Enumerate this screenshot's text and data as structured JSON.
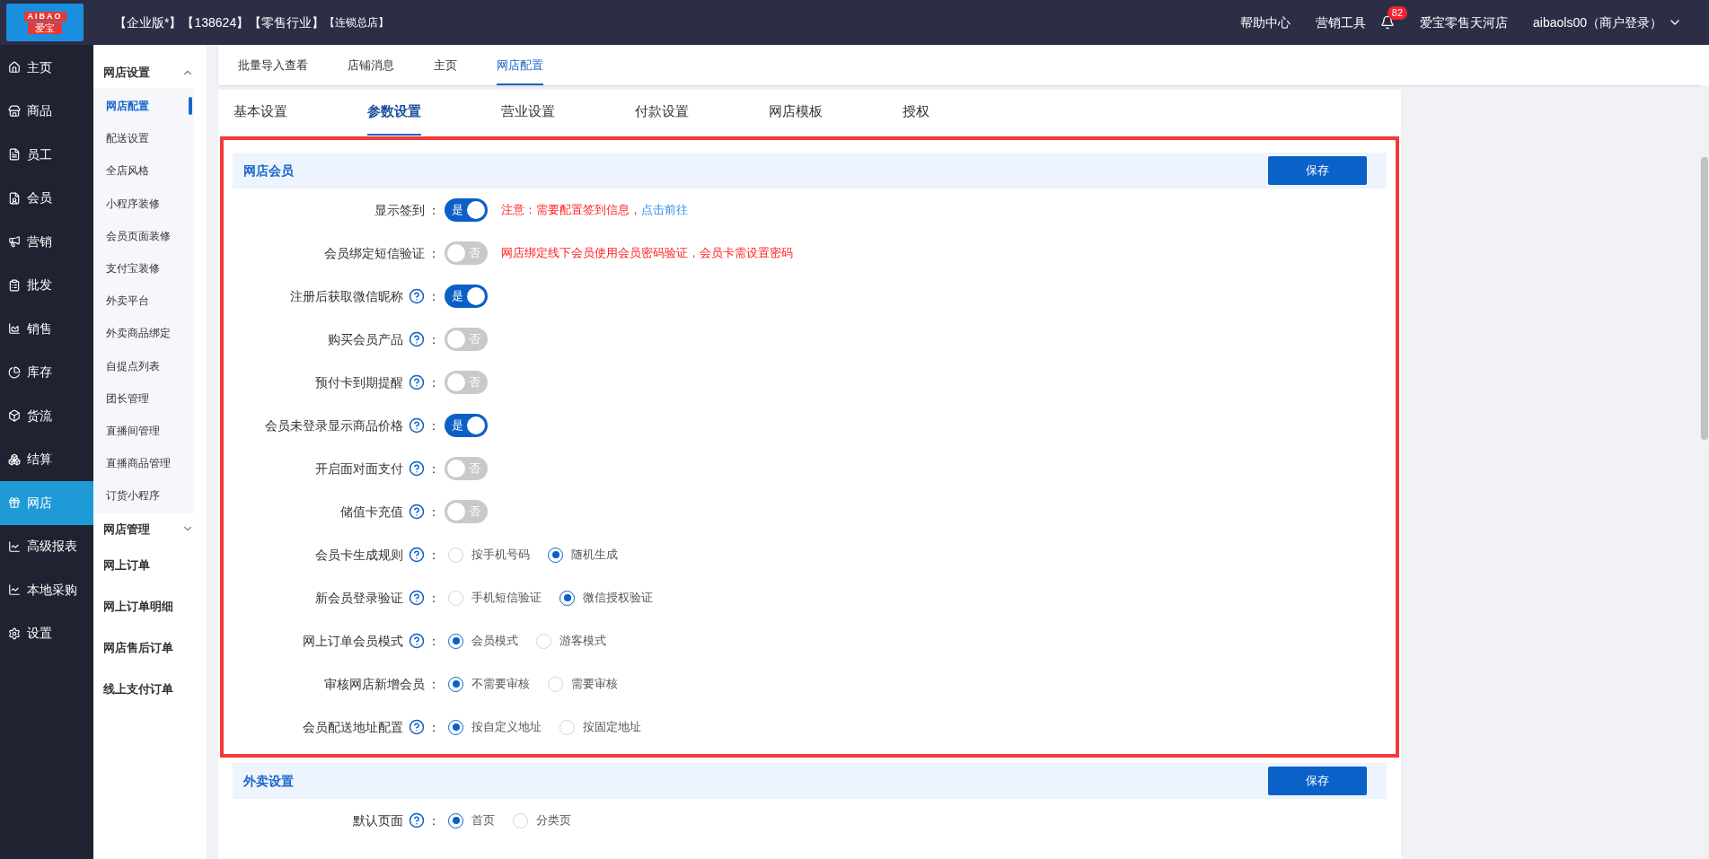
{
  "logo": {
    "text": "AIBAO",
    "subtext": "爱宝"
  },
  "header": {
    "tags": [
      {
        "text": "【企业版*】",
        "small": false
      },
      {
        "text": "【138624】",
        "small": false
      },
      {
        "text": "【零售行业】",
        "small": false
      },
      {
        "text": "【连锁总店】",
        "small": true
      }
    ],
    "links": [
      "帮助中心",
      "营销工具"
    ],
    "notification_count": "82",
    "store": "爱宝零售天河店",
    "user": "aibaols00（商户登录）"
  },
  "nav": [
    {
      "label": "主页",
      "selected": false
    },
    {
      "label": "商品",
      "selected": false
    },
    {
      "label": "员工",
      "selected": false
    },
    {
      "label": "会员",
      "selected": false
    },
    {
      "label": "营销",
      "selected": false
    },
    {
      "label": "批发",
      "selected": false
    },
    {
      "label": "销售",
      "selected": false
    },
    {
      "label": "库存",
      "selected": false
    },
    {
      "label": "货流",
      "selected": false
    },
    {
      "label": "结算",
      "selected": false
    },
    {
      "label": "网店",
      "selected": true
    },
    {
      "label": "高级报表",
      "selected": false
    },
    {
      "label": "本地采购",
      "selected": false
    },
    {
      "label": "设置",
      "selected": false
    }
  ],
  "submenu": [
    {
      "kind": "group",
      "label": "网店设置",
      "expanded": true,
      "children": [
        {
          "label": "网店配置",
          "selected": true
        },
        {
          "label": "配送设置",
          "selected": false
        },
        {
          "label": "全店风格",
          "selected": false
        },
        {
          "label": "小程序装修",
          "selected": false
        },
        {
          "label": "会员页面装修",
          "selected": false
        },
        {
          "label": "支付宝装修",
          "selected": false
        },
        {
          "label": "外卖平台",
          "selected": false
        },
        {
          "label": "外卖商品绑定",
          "selected": false
        },
        {
          "label": "自提点列表",
          "selected": false
        },
        {
          "label": "团长管理",
          "selected": false
        },
        {
          "label": "直播间管理",
          "selected": false
        },
        {
          "label": "直播商品管理",
          "selected": false
        },
        {
          "label": "订货小程序",
          "selected": false
        }
      ]
    },
    {
      "kind": "group",
      "label": "网店管理",
      "expanded": false
    },
    {
      "kind": "link",
      "label": "网上订单"
    },
    {
      "kind": "link",
      "label": "网上订单明细"
    },
    {
      "kind": "link",
      "label": "网店售后订单"
    },
    {
      "kind": "link",
      "label": "线上支付订单"
    }
  ],
  "page_tabs": [
    {
      "label": "批量导入查看",
      "selected": false
    },
    {
      "label": "店铺消息",
      "selected": false
    },
    {
      "label": "主页",
      "selected": false
    },
    {
      "label": "网店配置",
      "selected": true
    }
  ],
  "settings_tabs": [
    {
      "label": "基本设置",
      "selected": false
    },
    {
      "label": "参数设置",
      "selected": true
    },
    {
      "label": "营业设置",
      "selected": false
    },
    {
      "label": "付款设置",
      "selected": false
    },
    {
      "label": "网店模板",
      "selected": false
    },
    {
      "label": "授权",
      "selected": false
    }
  ],
  "sections": [
    {
      "title": "网店会员",
      "highlighted": true,
      "save": "保存",
      "rows": [
        {
          "kind": "toggle",
          "label": "显示签到",
          "help": false,
          "suffix": "：",
          "on": true,
          "switch_text": "是",
          "note": {
            "text": "注意：需要配置签到信息，",
            "link": "点击前往"
          }
        },
        {
          "kind": "toggle",
          "label": "会员绑定短信验证",
          "help": false,
          "suffix": "：",
          "on": false,
          "switch_text": "否",
          "note": {
            "text": "网店绑定线下会员使用会员密码验证，会员卡需设置密码"
          }
        },
        {
          "kind": "toggle",
          "label": "注册后获取微信昵称",
          "help": true,
          "suffix": "：",
          "on": true,
          "switch_text": "是"
        },
        {
          "kind": "toggle",
          "label": "购买会员产品",
          "help": true,
          "suffix": "：",
          "on": false,
          "switch_text": "否"
        },
        {
          "kind": "toggle",
          "label": "预付卡到期提醒",
          "help": true,
          "suffix": "：",
          "on": false,
          "switch_text": "否"
        },
        {
          "kind": "toggle",
          "label": "会员未登录显示商品价格",
          "help": true,
          "suffix": "：",
          "on": true,
          "switch_text": "是"
        },
        {
          "kind": "toggle",
          "label": "开启面对面支付",
          "help": true,
          "suffix": "：",
          "on": false,
          "switch_text": "否"
        },
        {
          "kind": "toggle",
          "label": "储值卡充值",
          "help": true,
          "suffix": "：",
          "on": false,
          "switch_text": "否"
        },
        {
          "kind": "radio",
          "label": "会员卡生成规则",
          "help": true,
          "suffix": "：",
          "options": [
            {
              "label": "按手机号码",
              "selected": false
            },
            {
              "label": "随机生成",
              "selected": true
            }
          ]
        },
        {
          "kind": "radio",
          "label": "新会员登录验证",
          "help": true,
          "suffix": "：",
          "options": [
            {
              "label": "手机短信验证",
              "selected": false
            },
            {
              "label": "微信授权验证",
              "selected": true
            }
          ]
        },
        {
          "kind": "radio",
          "label": "网上订单会员模式",
          "help": true,
          "suffix": "：",
          "options": [
            {
              "label": "会员模式",
              "selected": true
            },
            {
              "label": "游客模式",
              "selected": false
            }
          ]
        },
        {
          "kind": "radio",
          "label": "审核网店新增会员",
          "help": false,
          "suffix": "：",
          "options": [
            {
              "label": "不需要审核",
              "selected": true
            },
            {
              "label": "需要审核",
              "selected": false
            }
          ]
        },
        {
          "kind": "radio",
          "label": "会员配送地址配置",
          "help": true,
          "suffix": "：",
          "options": [
            {
              "label": "按自定义地址",
              "selected": true
            },
            {
              "label": "按固定地址",
              "selected": false
            }
          ]
        }
      ]
    },
    {
      "title": "外卖设置",
      "highlighted": false,
      "save": "保存",
      "rows": [
        {
          "kind": "radio",
          "label": "默认页面",
          "help": true,
          "suffix": "：",
          "options": [
            {
              "label": "首页",
              "selected": true
            },
            {
              "label": "分类页",
              "selected": false
            }
          ]
        }
      ]
    }
  ]
}
